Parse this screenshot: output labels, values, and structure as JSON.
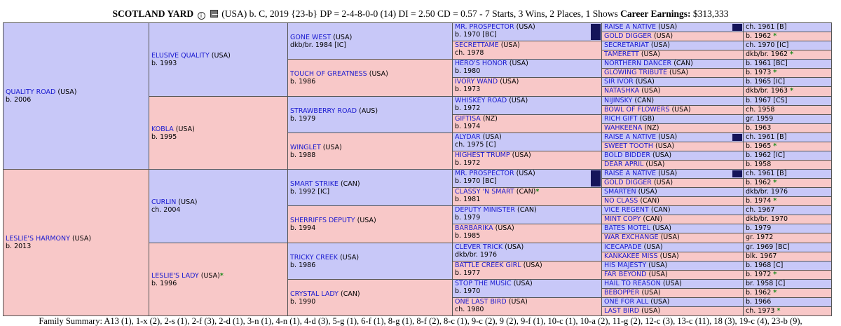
{
  "header": {
    "horse_name": "SCOTLAND YARD",
    "info_icon": "info-icon",
    "mail_icon": "envelope-icon",
    "details": "(USA) b. C, 2019 {23-b} DP = 2-4-8-0-0 (14) DI = 2.50   CD = 0.57 - 7 Starts, 3 Wins, 2 Places, 1 Shows",
    "earnings_label": "Career Earnings:",
    "earnings_value": "$313,333"
  },
  "colors": {
    "male": "#c8c8f8",
    "female": "#f8c8c8",
    "name": "#1a1ad0",
    "star": "#1a8a1a",
    "mark": "#14145a"
  },
  "gen1": [
    {
      "name": "QUALITY ROAD",
      "country": "(USA)",
      "info": "b. 2006",
      "sex": "m"
    },
    {
      "name": "LESLIE'S HARMONY",
      "country": "(USA)",
      "info": "b. 2013",
      "sex": "f"
    }
  ],
  "gen2": [
    {
      "name": "ELUSIVE QUALITY",
      "country": "(USA)",
      "info": "b. 1993",
      "sex": "m"
    },
    {
      "name": "KOBLA",
      "country": "(USA)",
      "info": "b. 1995",
      "sex": "f"
    },
    {
      "name": "CURLIN",
      "country": "(USA)",
      "info": "ch. 2004",
      "sex": "m"
    },
    {
      "name": "LESLIE'S LADY",
      "country": "(USA)",
      "star": "*",
      "info": "b. 1996",
      "sex": "f"
    }
  ],
  "gen3": [
    {
      "name": "GONE WEST",
      "country": "(USA)",
      "info": "dkb/br. 1984 [IC]",
      "sex": "m"
    },
    {
      "name": "TOUCH OF GREATNESS",
      "country": "(USA)",
      "info": "b. 1986",
      "sex": "f"
    },
    {
      "name": "STRAWBERRY ROAD",
      "country": "(AUS)",
      "info": "b. 1979",
      "sex": "m"
    },
    {
      "name": "WINGLET",
      "country": "(USA)",
      "info": "b. 1988",
      "sex": "f"
    },
    {
      "name": "SMART STRIKE",
      "country": "(CAN)",
      "info": "b. 1992 [IC]",
      "sex": "m"
    },
    {
      "name": "SHERRIFFS DEPUTY",
      "country": "(USA)",
      "info": "b. 1994",
      "sex": "f"
    },
    {
      "name": "TRICKY CREEK",
      "country": "(USA)",
      "info": "b. 1986",
      "sex": "m"
    },
    {
      "name": "CRYSTAL LADY",
      "country": "(CAN)",
      "info": "b. 1990",
      "sex": "f"
    }
  ],
  "gen4": [
    {
      "name": "MR. PROSPECTOR",
      "country": "(USA)",
      "info": "b. 1970 [BC]",
      "sex": "m",
      "mark": true
    },
    {
      "name": "SECRETTAME",
      "country": "(USA)",
      "info": "ch. 1978",
      "sex": "f"
    },
    {
      "name": "HERO'S HONOR",
      "country": "(USA)",
      "info": "b. 1980",
      "sex": "m"
    },
    {
      "name": "IVORY WAND",
      "country": "(USA)",
      "info": "b. 1973",
      "sex": "f"
    },
    {
      "name": "WHISKEY ROAD",
      "country": "(USA)",
      "info": "b. 1972",
      "sex": "m"
    },
    {
      "name": "GIFTISA",
      "country": "(NZ)",
      "info": "b. 1974",
      "sex": "f"
    },
    {
      "name": "ALYDAR",
      "country": "(USA)",
      "info": "ch. 1975 [C]",
      "sex": "m"
    },
    {
      "name": "HIGHEST TRUMP",
      "country": "(USA)",
      "info": "b. 1972",
      "sex": "f"
    },
    {
      "name": "MR. PROSPECTOR",
      "country": "(USA)",
      "info": "b. 1970 [BC]",
      "sex": "m",
      "mark": true
    },
    {
      "name": "CLASSY 'N SMART",
      "country": "(CAN)",
      "star": "*",
      "info": "b. 1981",
      "sex": "f"
    },
    {
      "name": "DEPUTY MINISTER",
      "country": "(CAN)",
      "info": "b. 1979",
      "sex": "m"
    },
    {
      "name": "BARBARIKA",
      "country": "(USA)",
      "info": "b. 1985",
      "sex": "f"
    },
    {
      "name": "CLEVER TRICK",
      "country": "(USA)",
      "info": "dkb/br. 1976",
      "sex": "m"
    },
    {
      "name": "BATTLE CREEK GIRL",
      "country": "(USA)",
      "info": "b. 1977",
      "sex": "f"
    },
    {
      "name": "STOP THE MUSIC",
      "country": "(USA)",
      "info": "b. 1970",
      "sex": "m"
    },
    {
      "name": "ONE LAST BIRD",
      "country": "(USA)",
      "info": "ch. 1980",
      "sex": "f"
    }
  ],
  "gen5": [
    {
      "name": "RAISE A NATIVE",
      "country": "(USA)",
      "info": "ch. 1961 [B]",
      "sex": "m",
      "mark": true
    },
    {
      "name": "GOLD DIGGER",
      "country": "(USA)",
      "info": "b. 1962",
      "star": "*",
      "sex": "f"
    },
    {
      "name": "SECRETARIAT",
      "country": "(USA)",
      "info": "ch. 1970 [IC]",
      "sex": "m"
    },
    {
      "name": "TAMERETT",
      "country": "(USA)",
      "info": "dkb/br. 1962",
      "star": "*",
      "sex": "f"
    },
    {
      "name": "NORTHERN DANCER",
      "country": "(CAN)",
      "info": "b. 1961 [BC]",
      "sex": "m"
    },
    {
      "name": "GLOWING TRIBUTE",
      "country": "(USA)",
      "info": "b. 1973",
      "star": "*",
      "sex": "f"
    },
    {
      "name": "SIR IVOR",
      "country": "(USA)",
      "info": "b. 1965 [IC]",
      "sex": "m"
    },
    {
      "name": "NATASHKA",
      "country": "(USA)",
      "info": "dkb/br. 1963",
      "star": "*",
      "sex": "f"
    },
    {
      "name": "NIJINSKY",
      "country": "(CAN)",
      "info": "b. 1967 [CS]",
      "sex": "m"
    },
    {
      "name": "BOWL OF FLOWERS",
      "country": "(USA)",
      "info": "ch. 1958",
      "sex": "f"
    },
    {
      "name": "RICH GIFT",
      "country": "(GB)",
      "info": "gr. 1959",
      "sex": "m"
    },
    {
      "name": "WAHKEENA",
      "country": "(NZ)",
      "info": "b. 1963",
      "sex": "f"
    },
    {
      "name": "RAISE A NATIVE",
      "country": "(USA)",
      "info": "ch. 1961 [B]",
      "sex": "m",
      "mark": true
    },
    {
      "name": "SWEET TOOTH",
      "country": "(USA)",
      "info": "b. 1965",
      "star": "*",
      "sex": "f"
    },
    {
      "name": "BOLD BIDDER",
      "country": "(USA)",
      "info": "b. 1962 [IC]",
      "sex": "m"
    },
    {
      "name": "DEAR APRIL",
      "country": "(USA)",
      "info": "b. 1958",
      "sex": "f"
    },
    {
      "name": "RAISE A NATIVE",
      "country": "(USA)",
      "info": "ch. 1961 [B]",
      "sex": "m",
      "mark": true
    },
    {
      "name": "GOLD DIGGER",
      "country": "(USA)",
      "info": "b. 1962",
      "star": "*",
      "sex": "f"
    },
    {
      "name": "SMARTEN",
      "country": "(USA)",
      "info": "dkb/br. 1976",
      "sex": "m"
    },
    {
      "name": "NO CLASS",
      "country": "(CAN)",
      "info": "b. 1974",
      "star": "*",
      "sex": "f"
    },
    {
      "name": "VICE REGENT",
      "country": "(CAN)",
      "info": "ch. 1967",
      "sex": "m"
    },
    {
      "name": "MINT COPY",
      "country": "(CAN)",
      "info": "dkb/br. 1970",
      "sex": "f"
    },
    {
      "name": "BATES MOTEL",
      "country": "(USA)",
      "info": "b. 1979",
      "sex": "m"
    },
    {
      "name": "WAR EXCHANGE",
      "country": "(USA)",
      "info": "gr. 1972",
      "sex": "f"
    },
    {
      "name": "ICECAPADE",
      "country": "(USA)",
      "info": "gr. 1969 [BC]",
      "sex": "m"
    },
    {
      "name": "KANKAKEE MISS",
      "country": "(USA)",
      "info": "blk. 1967",
      "sex": "f"
    },
    {
      "name": "HIS MAJESTY",
      "country": "(USA)",
      "info": "b. 1968 [C]",
      "sex": "m"
    },
    {
      "name": "FAR BEYOND",
      "country": "(USA)",
      "info": "b. 1972",
      "star": "*",
      "sex": "f"
    },
    {
      "name": "HAIL TO REASON",
      "country": "(USA)",
      "info": "br. 1958 [C]",
      "sex": "m"
    },
    {
      "name": "BEBOPPER",
      "country": "(USA)",
      "info": "b. 1962",
      "star": "*",
      "sex": "f"
    },
    {
      "name": "ONE FOR ALL",
      "country": "(USA)",
      "info": "b. 1966",
      "sex": "m"
    },
    {
      "name": "LAST BIRD",
      "country": "(USA)",
      "info": "ch. 1973",
      "star": "*",
      "sex": "f"
    }
  ],
  "footer": {
    "text": "Family Summary: A13 (1), 1-x (2), 2-s (1), 2-f (3), 2-d (1), 3-n (1), 4-n (1), 4-d (3), 5-g (1), 6-f (1), 8-g (1), 8-f (2), 8-c (1), 9-c (2), 9 (2), 9-f (1), 10-c (1), 10-a (2), 11-g (2), 12-c (3), 13-c (11), 18 (3), 19-c (4), 23-b (9),"
  }
}
